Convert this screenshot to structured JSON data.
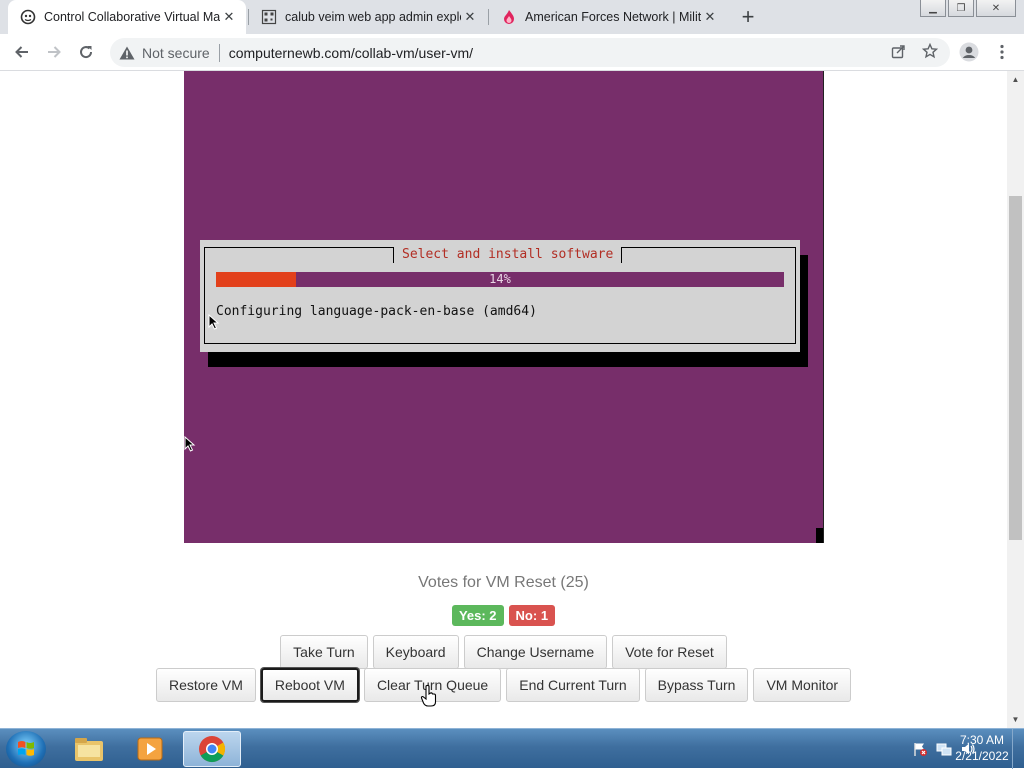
{
  "browser": {
    "tabs": [
      {
        "title": "Control Collaborative Virtual Ma",
        "icon": "collabvm-icon",
        "active": true
      },
      {
        "title": "calub veim web app admin explo",
        "icon": "qr-icon",
        "active": false
      },
      {
        "title": "American Forces Network | Milita",
        "icon": "afn-icon",
        "active": false
      }
    ],
    "new_tab_label": "+",
    "security_label": "Not secure",
    "url": "computernewb.com/collab-vm/user-vm/"
  },
  "vm": {
    "background_color": "#772e6a",
    "dialog": {
      "title": "Select and install software",
      "progress_percent": 14,
      "progress_text": "14%",
      "status": "Configuring language-pack-en-base (amd64)"
    }
  },
  "votes": {
    "label": "Votes for VM Reset (25)",
    "yes_label": "Yes: 2",
    "no_label": "No: 1"
  },
  "buttons": {
    "row1": [
      "Take Turn",
      "Keyboard",
      "Change Username",
      "Vote for Reset"
    ],
    "row2": [
      "Restore VM",
      "Reboot VM",
      "Clear Turn Queue",
      "End Current Turn",
      "Bypass Turn",
      "VM Monitor"
    ]
  },
  "taskbar": {
    "apps": [
      "explorer-icon",
      "media-player-icon",
      "chrome-icon"
    ],
    "time": "7:30 AM",
    "date": "2/21/2022"
  }
}
